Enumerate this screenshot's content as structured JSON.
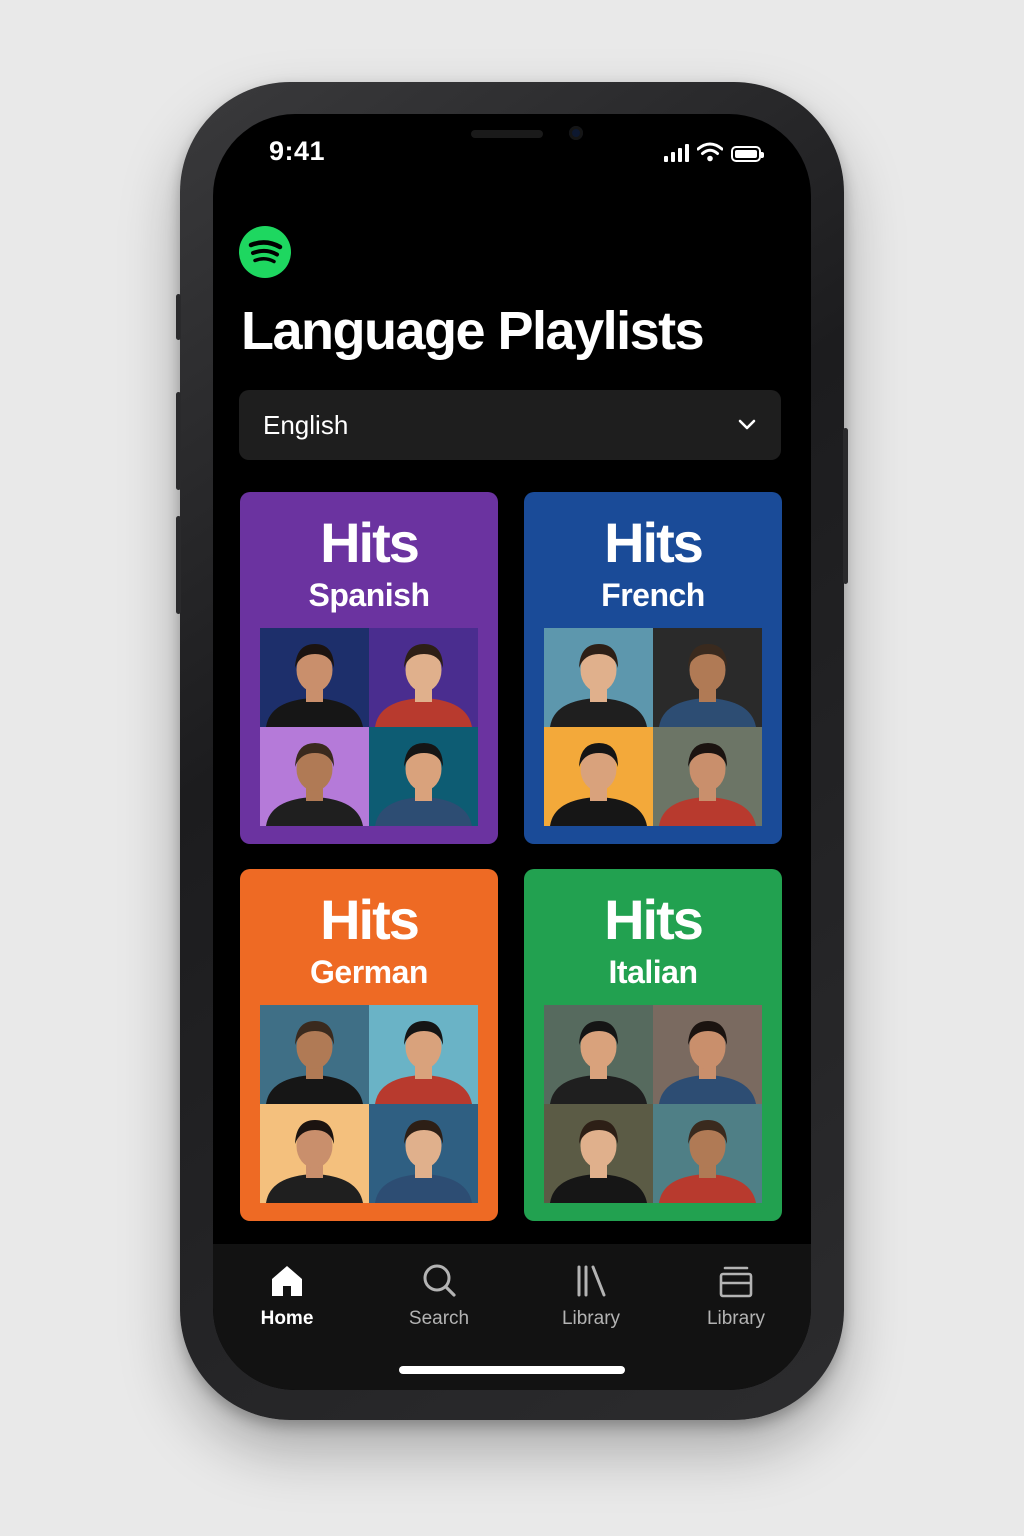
{
  "status_bar": {
    "time": "9:41"
  },
  "header": {
    "title": "Language Playlists"
  },
  "language_select": {
    "selected": "English"
  },
  "playlists": [
    {
      "title": "Hits",
      "language": "Spanish",
      "color": "#6b33a0",
      "tiles": [
        "#1d2f6b",
        "#4a2d8f",
        "#b57ad9",
        "#0d5c73"
      ]
    },
    {
      "title": "Hits",
      "language": "French",
      "color": "#1a4b98",
      "tiles": [
        "#5d97ad",
        "#2a2a2a",
        "#f3a93a",
        "#6c7566"
      ]
    },
    {
      "title": "Hits",
      "language": "German",
      "color": "#ee6a24",
      "tiles": [
        "#3f6f86",
        "#6ab3c6",
        "#f4c07d",
        "#2f5f82"
      ]
    },
    {
      "title": "Hits",
      "language": "Italian",
      "color": "#22a150",
      "tiles": [
        "#566a5e",
        "#7a6a60",
        "#5b5b45",
        "#4f7f86"
      ]
    }
  ],
  "tab_bar": {
    "tabs": [
      {
        "label": "Home",
        "icon": "home-icon",
        "active": true
      },
      {
        "label": "Search",
        "icon": "search-icon",
        "active": false
      },
      {
        "label": "Library",
        "icon": "library-icon",
        "active": false
      },
      {
        "label": "Library",
        "icon": "stack-icon",
        "active": false
      }
    ]
  },
  "colors": {
    "brand_green": "#1ed760",
    "background": "#000000"
  }
}
